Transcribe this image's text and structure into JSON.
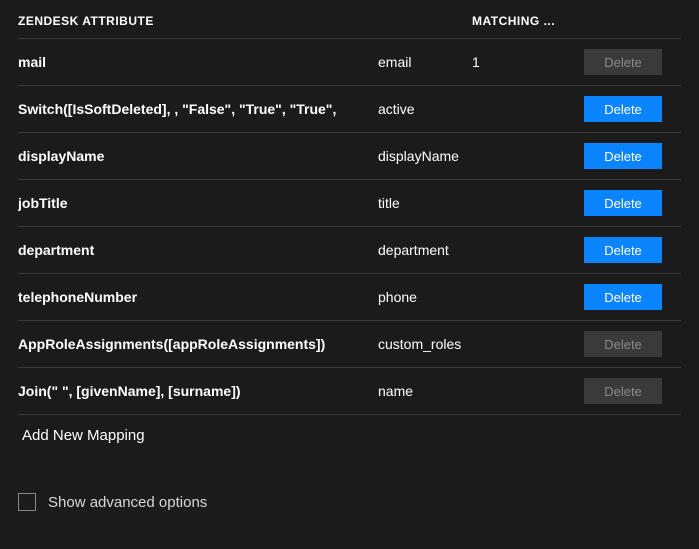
{
  "headers": {
    "zendesk_attr": "Zendesk Attribute",
    "matching": "Matching ..."
  },
  "rows": [
    {
      "source": "mail",
      "target": "email",
      "matching": "1",
      "delete_label": "Delete",
      "delete_enabled": false
    },
    {
      "source": "Switch([IsSoftDeleted], , \"False\", \"True\", \"True\",",
      "target": "active",
      "matching": "",
      "delete_label": "Delete",
      "delete_enabled": true
    },
    {
      "source": "displayName",
      "target": "displayName",
      "matching": "",
      "delete_label": "Delete",
      "delete_enabled": true
    },
    {
      "source": "jobTitle",
      "target": "title",
      "matching": "",
      "delete_label": "Delete",
      "delete_enabled": true
    },
    {
      "source": "department",
      "target": "department",
      "matching": "",
      "delete_label": "Delete",
      "delete_enabled": true
    },
    {
      "source": "telephoneNumber",
      "target": "phone",
      "matching": "",
      "delete_label": "Delete",
      "delete_enabled": true
    },
    {
      "source": "AppRoleAssignments([appRoleAssignments])",
      "target": "custom_roles",
      "matching": "",
      "delete_label": "Delete",
      "delete_enabled": false
    },
    {
      "source": "Join(\" \", [givenName], [surname])",
      "target": "name",
      "matching": "",
      "delete_label": "Delete",
      "delete_enabled": false
    }
  ],
  "add_mapping_label": "Add New Mapping",
  "footer": {
    "show_advanced_label": "Show advanced options",
    "show_advanced_checked": false
  }
}
